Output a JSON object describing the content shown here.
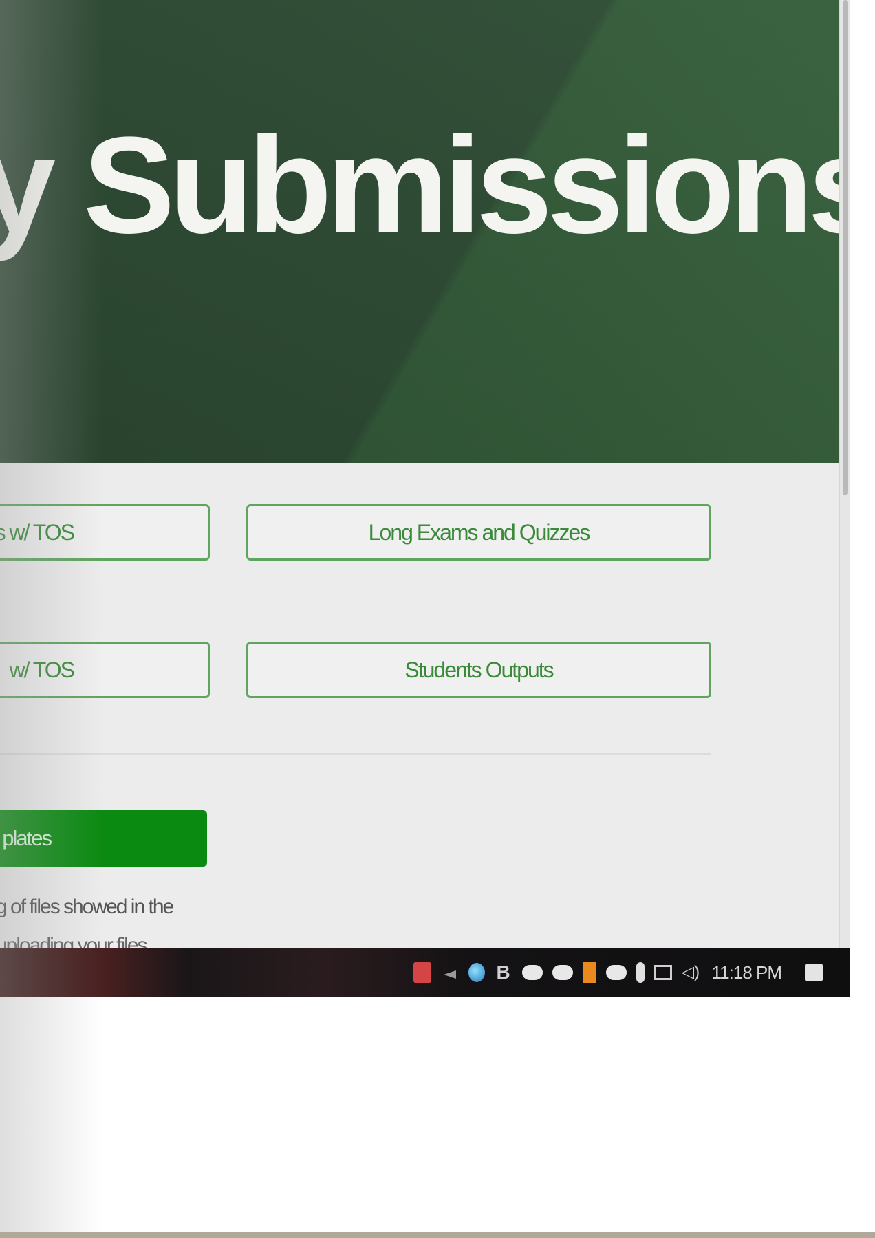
{
  "hero": {
    "title": "y Submissions"
  },
  "buttons": {
    "top_left": "s w/ TOS",
    "top_right": "Long Exams and Quizzes",
    "bottom_left": "w/ TOS",
    "bottom_right": "Students Outputs",
    "templates": "plates"
  },
  "notes": {
    "line1": "g of files showed in the",
    "line2": "uploading your files"
  },
  "taskbar": {
    "clock": "11:18 PM",
    "tray_icons": [
      "pdf-icon",
      "arrow-icon",
      "droplet-icon",
      "b-icon",
      "cloud-upload-icon",
      "cloud-upload-icon",
      "orange-app-icon",
      "cloud-icon",
      "mic-icon",
      "network-icon",
      "speaker-icon"
    ],
    "notification_icon": "notification-icon"
  },
  "colors": {
    "hero_green": "#2e4c34",
    "button_border": "#5fa45f",
    "button_text": "#3a8a3a",
    "templates_green": "#0b8a12",
    "taskbar": "#141214"
  }
}
